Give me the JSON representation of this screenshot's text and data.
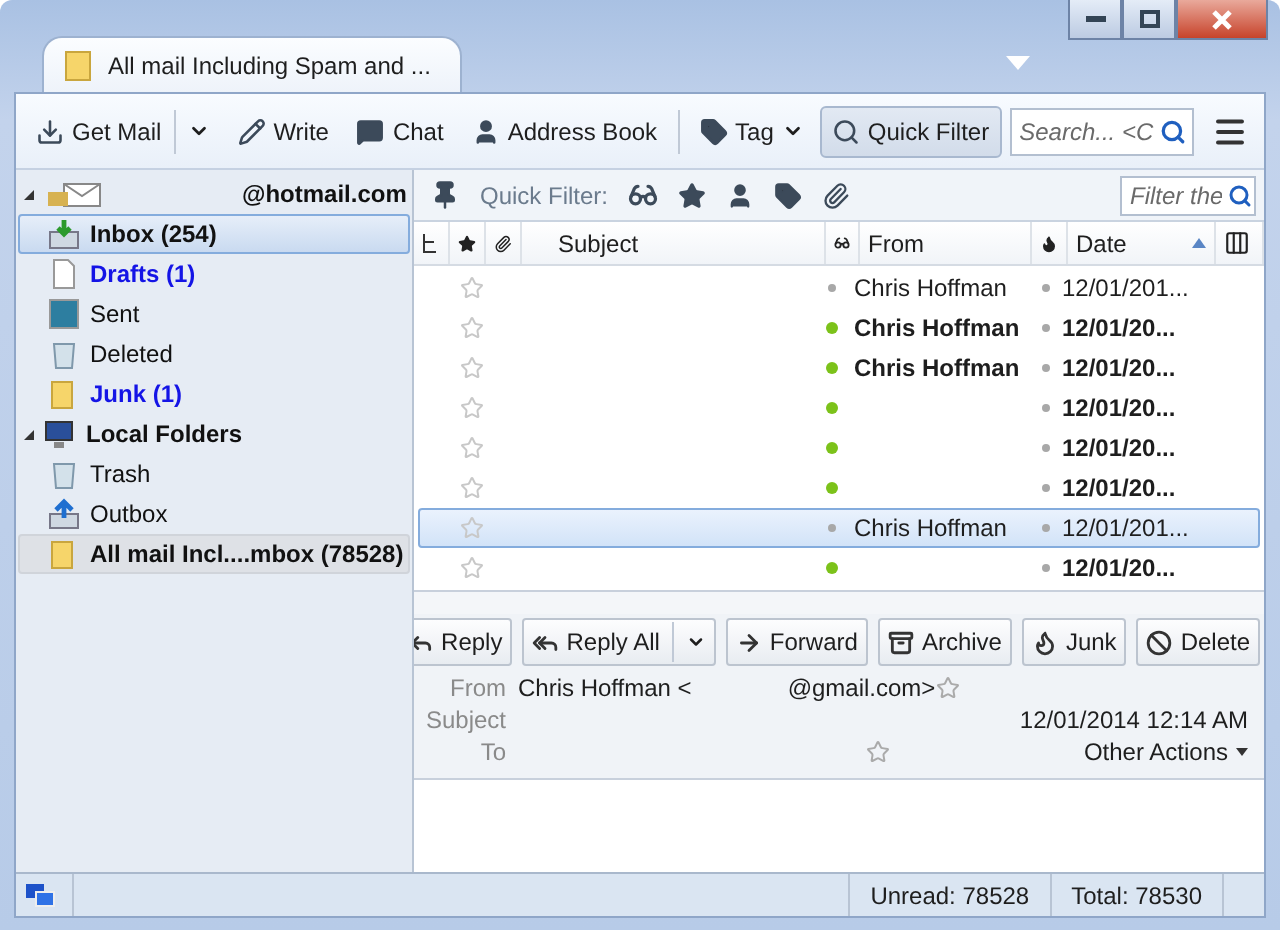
{
  "window": {
    "tab_title": "All mail Including Spam and ..."
  },
  "toolbar": {
    "buttons": [
      {
        "label": "Get Mail",
        "split": true,
        "menu": false,
        "pressed": false
      },
      {
        "label": "Write",
        "split": false,
        "menu": false,
        "pressed": false
      },
      {
        "label": "Chat",
        "split": false,
        "menu": false,
        "pressed": false
      },
      {
        "label": "Address Book",
        "split": false,
        "menu": false,
        "pressed": false
      },
      {
        "label": "Tag",
        "split": false,
        "menu": true,
        "pressed": false
      },
      {
        "label": "Quick Filter",
        "split": false,
        "menu": false,
        "pressed": true
      }
    ],
    "search": {
      "placeholder": "Search... <C"
    }
  },
  "folders": [
    {
      "label": "@hotmail.com",
      "expanded": true,
      "children": [
        {
          "label": "Inbox (254)",
          "bold": true,
          "unread": false,
          "highlighted": true,
          "selected": false
        },
        {
          "label": "Drafts (1)",
          "bold": true,
          "unread": true,
          "highlighted": false,
          "selected": false
        },
        {
          "label": "Sent",
          "bold": false,
          "unread": false,
          "highlighted": false,
          "selected": false
        },
        {
          "label": "Deleted",
          "bold": false,
          "unread": false,
          "highlighted": false,
          "selected": false
        },
        {
          "label": "Junk (1)",
          "bold": true,
          "unread": true,
          "highlighted": false,
          "selected": false
        }
      ]
    },
    {
      "label": "Local Folders",
      "expanded": true,
      "children": [
        {
          "label": "Trash",
          "bold": false,
          "unread": false,
          "highlighted": false,
          "selected": false
        },
        {
          "label": "Outbox",
          "bold": false,
          "unread": false,
          "highlighted": false,
          "selected": false
        },
        {
          "label": "All mail Incl....mbox (78528)",
          "bold": true,
          "unread": false,
          "highlighted": false,
          "selected": true
        }
      ]
    }
  ],
  "quick_filter": {
    "label": "Quick Filter:",
    "placeholder": "Filter the"
  },
  "columns": {
    "subject": "Subject",
    "from": "From",
    "date": "Date"
  },
  "messages": [
    {
      "from": "Chris Hoffman",
      "date": "12/01/201...",
      "unread": false,
      "selected": false
    },
    {
      "from": "Chris Hoffman",
      "date": "12/01/20...",
      "unread": true,
      "selected": false
    },
    {
      "from": "Chris Hoffman",
      "date": "12/01/20...",
      "unread": true,
      "selected": false
    },
    {
      "date": "12/01/20...",
      "unread": true,
      "selected": false
    },
    {
      "date": "12/01/20...",
      "unread": true,
      "selected": false
    },
    {
      "date": "12/01/20...",
      "unread": true,
      "selected": false
    },
    {
      "from": "Chris Hoffman",
      "date": "12/01/201...",
      "unread": false,
      "selected": true
    },
    {
      "date": "12/01/20...",
      "unread": true,
      "selected": false
    }
  ],
  "message_actions": [
    {
      "label": "Reply",
      "split": false
    },
    {
      "label": "Reply All",
      "split": true
    },
    {
      "label": "Forward",
      "split": false
    },
    {
      "label": "Archive",
      "split": false
    },
    {
      "label": "Junk",
      "split": false
    },
    {
      "label": "Delete",
      "split": false
    }
  ],
  "message_header": {
    "from_label": "From",
    "from_name": "Chris Hoffman <",
    "from_domain": "@gmail.com>",
    "subject_label": "Subject",
    "date": "12/01/2014 12:14 AM",
    "to_label": "To",
    "other_actions": "Other Actions"
  },
  "status_bar": {
    "unread": "Unread: 78528",
    "total": "Total: 78530"
  }
}
